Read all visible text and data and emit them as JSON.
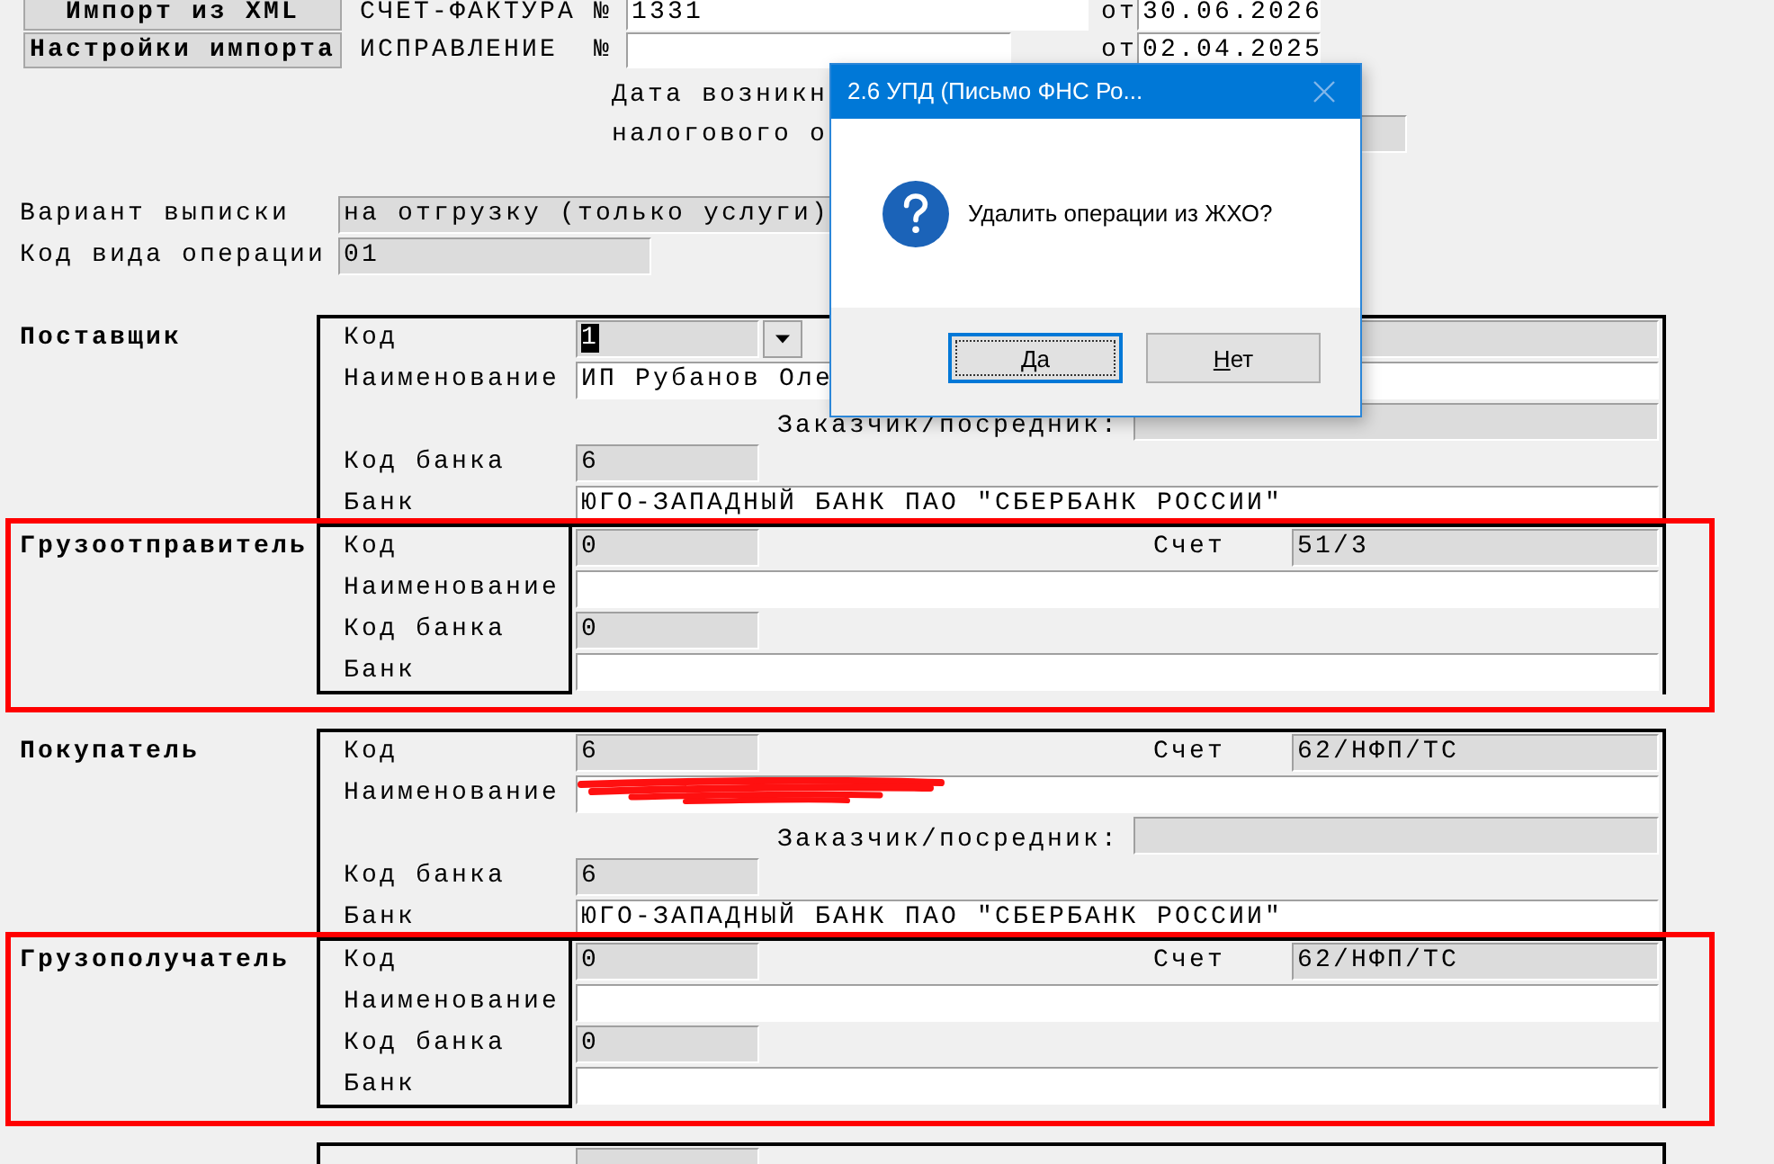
{
  "form": {
    "buttons": [
      {
        "label": "Импорт из XML"
      },
      {
        "label": "Настройки импорта"
      }
    ],
    "header_rows": [
      {
        "kind": "invoice",
        "label": "СЧЕТ-ФАКТУРА №",
        "number": "1331",
        "date_label": "от",
        "date": "30.06.2026"
      },
      {
        "kind": "correction",
        "label": "ИСПРАВЛЕНИЕ  №",
        "date_label": "от",
        "date": "02.04.2025"
      }
    ],
    "tax_date": {
      "lines": [
        "Дата возникн",
        "налогового о"
      ]
    },
    "fields": [
      {
        "kind": "wide",
        "label": "Вариант выписки",
        "value": "на отгрузку (только услуги)"
      },
      {
        "kind": "narrow",
        "label": "Код вида операции",
        "value": "01"
      }
    ],
    "groups": [
      {
        "sections": [
          {
            "heading": "Поставщик",
            "highlighted": false,
            "rows": [
              {
                "kind": "code",
                "label": "Код",
                "value": "1",
                "value_selected": true,
                "dropdown": true,
                "account": true
              },
              {
                "kind": "wide",
                "label": "Наименование",
                "value": "ИП Рубанов Оле",
                "redacted": false
              },
              {
                "kind": "customer",
                "label": "Заказчик/посредник:"
              },
              {
                "kind": "code",
                "label": "Код банка",
                "value": "6",
                "value_selected": false,
                "dropdown": false,
                "account": false
              },
              {
                "kind": "wide",
                "label": "Банк",
                "value": "ЮГО-ЗАПАДНЫЙ БАНК ПАО \"СБЕРБАНК РОССИИ\"",
                "redacted": false
              }
            ]
          },
          {
            "heading": "Грузоотправитель",
            "highlighted": true,
            "rows": [
              {
                "kind": "code",
                "label": "Код",
                "value": "0",
                "value_selected": false,
                "dropdown": false,
                "account": true,
                "account_label": "Счет",
                "account_value": "51/3"
              },
              {
                "kind": "wide",
                "label": "Наименование",
                "redacted": false
              },
              {
                "kind": "code",
                "label": "Код банка",
                "value": "0",
                "value_selected": false,
                "dropdown": false,
                "account": false
              },
              {
                "kind": "wide",
                "label": "Банк",
                "redacted": false
              }
            ]
          }
        ]
      },
      {
        "sections": [
          {
            "heading": "Покупатель",
            "highlighted": false,
            "rows": [
              {
                "kind": "code",
                "label": "Код",
                "value": "6",
                "value_selected": false,
                "dropdown": false,
                "account": true,
                "account_label": "Счет",
                "account_value": "62/НФП/ТС"
              },
              {
                "kind": "wide",
                "label": "Наименование",
                "redacted": true
              },
              {
                "kind": "customer",
                "label": "Заказчик/посредник:"
              },
              {
                "kind": "code",
                "label": "Код банка",
                "value": "6",
                "value_selected": false,
                "dropdown": false,
                "account": false
              },
              {
                "kind": "wide",
                "label": "Банк",
                "value": "ЮГО-ЗАПАДНЫЙ БАНК ПАО \"СБЕРБАНК РОССИИ\"",
                "redacted": false
              }
            ]
          },
          {
            "heading": "Грузополучатель",
            "highlighted": true,
            "rows": [
              {
                "kind": "code",
                "label": "Код",
                "value": "0",
                "value_selected": false,
                "dropdown": false,
                "account": true,
                "account_label": "Счет",
                "account_value": "62/НФП/ТС"
              },
              {
                "kind": "wide",
                "label": "Наименование",
                "redacted": false
              },
              {
                "kind": "code",
                "label": "Код банка",
                "value": "0",
                "value_selected": false,
                "dropdown": false,
                "account": false
              },
              {
                "kind": "wide",
                "label": "Банк",
                "redacted": false
              }
            ]
          }
        ]
      },
      {
        "sections": [
          {
            "highlighted": false,
            "rows": [
              {
                "kind": "code",
                "dropdown": false,
                "account": false
              }
            ]
          }
        ]
      }
    ]
  },
  "dialog": {
    "title": "2.6 УПД (Письмо ФНС Ро...",
    "message": "Удалить операции из ЖХО?",
    "buttons": [
      {
        "label": "Да",
        "selected": true
      },
      {
        "label": "Нет",
        "selected": false
      }
    ]
  }
}
